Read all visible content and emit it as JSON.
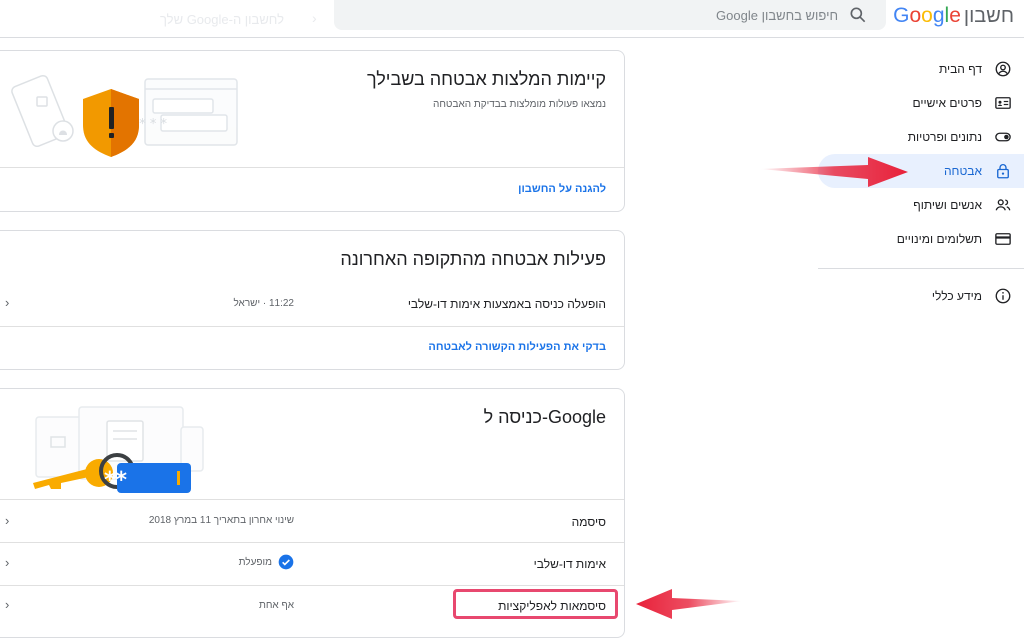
{
  "header": {
    "brand_letters": [
      "G",
      "o",
      "o",
      "g",
      "l",
      "e"
    ],
    "brand_colors": [
      "#4285F4",
      "#EA4335",
      "#FBBC05",
      "#4285F4",
      "#34A853",
      "#EA4335"
    ],
    "product": "חשבון",
    "search_placeholder": "חיפוש בחשבון Google",
    "faded_text": "לחשבון ה-Google שלך"
  },
  "sidebar": {
    "items": [
      {
        "label": "דף הבית",
        "icon": "person-circle-icon"
      },
      {
        "label": "פרטים אישיים",
        "icon": "id-card-icon"
      },
      {
        "label": "נתונים ופרטיות",
        "icon": "toggle-icon"
      },
      {
        "label": "אבטחה",
        "icon": "lock-icon",
        "active": true
      },
      {
        "label": "אנשים ושיתוף",
        "icon": "people-icon"
      },
      {
        "label": "תשלומים ומינויים",
        "icon": "credit-card-icon"
      }
    ],
    "info": {
      "label": "מידע כללי",
      "icon": "info-icon"
    }
  },
  "recommendations_card": {
    "title": "קיימות המלצות אבטחה בשבילך",
    "subtitle": "נמצאו פעולות מומלצות בבדיקת האבטחה",
    "link": "להגנה על החשבון"
  },
  "activity_card": {
    "title": "פעילות אבטחה מהתקופה האחרונה",
    "row_label": "הופעלה כניסה באמצעות אימות דו-שלבי",
    "row_value": "11:22 · ישראל",
    "link": "בדקי את הפעילות הקשורה לאבטחה"
  },
  "signin_card": {
    "title": "כניסה ל-Google",
    "rows": [
      {
        "label": "סיסמה",
        "value": "שינוי אחרון בתאריך 11 במרץ 2018"
      },
      {
        "label": "אימות דו-שלבי",
        "value": "מופעלת"
      },
      {
        "label": "סיסמאות לאפליקציות",
        "value": "אף אחת"
      }
    ],
    "password_mask": "**"
  },
  "colors": {
    "accent": "#1a73e8",
    "annotation_red": "#e8213a",
    "shield": "#f29900"
  }
}
